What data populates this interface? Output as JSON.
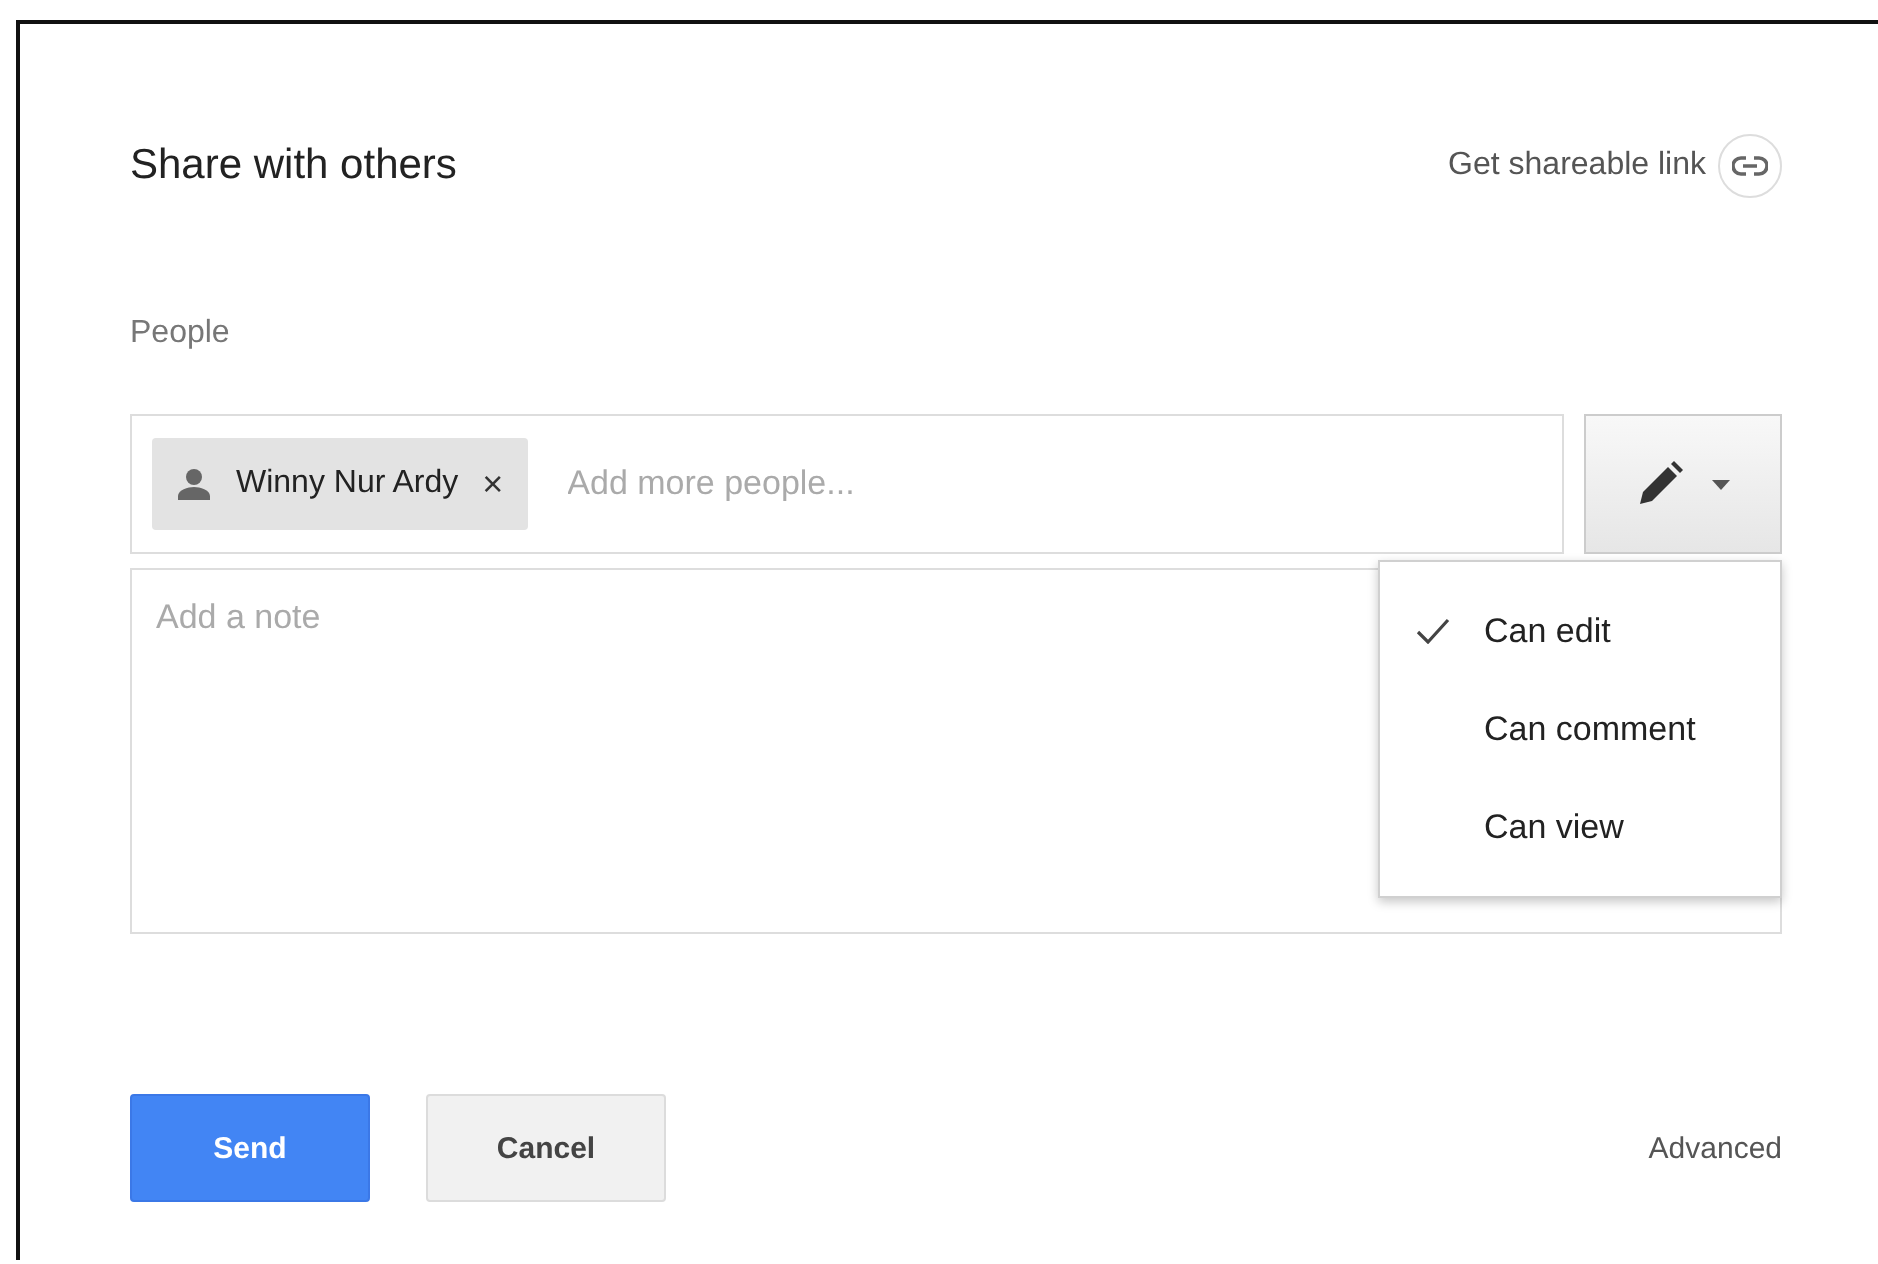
{
  "dialog": {
    "title": "Share with others",
    "link_button": "Get shareable link",
    "people_label": "People",
    "recipients": [
      {
        "name": "Winny Nur Ardy",
        "remove": "×"
      }
    ],
    "add_field": {
      "placeholder": "Add more people..."
    },
    "note_field": {
      "placeholder": "Add a note"
    },
    "permission_menu": {
      "expanded": true,
      "options": [
        {
          "label": "Can edit",
          "selected": true
        },
        {
          "label": "Can comment",
          "selected": false
        },
        {
          "label": "Can view",
          "selected": false
        }
      ]
    },
    "buttons": [
      {
        "label": "Send",
        "kind": "primary"
      },
      {
        "label": "Cancel",
        "kind": "secondary"
      }
    ],
    "advanced": "Advanced"
  }
}
